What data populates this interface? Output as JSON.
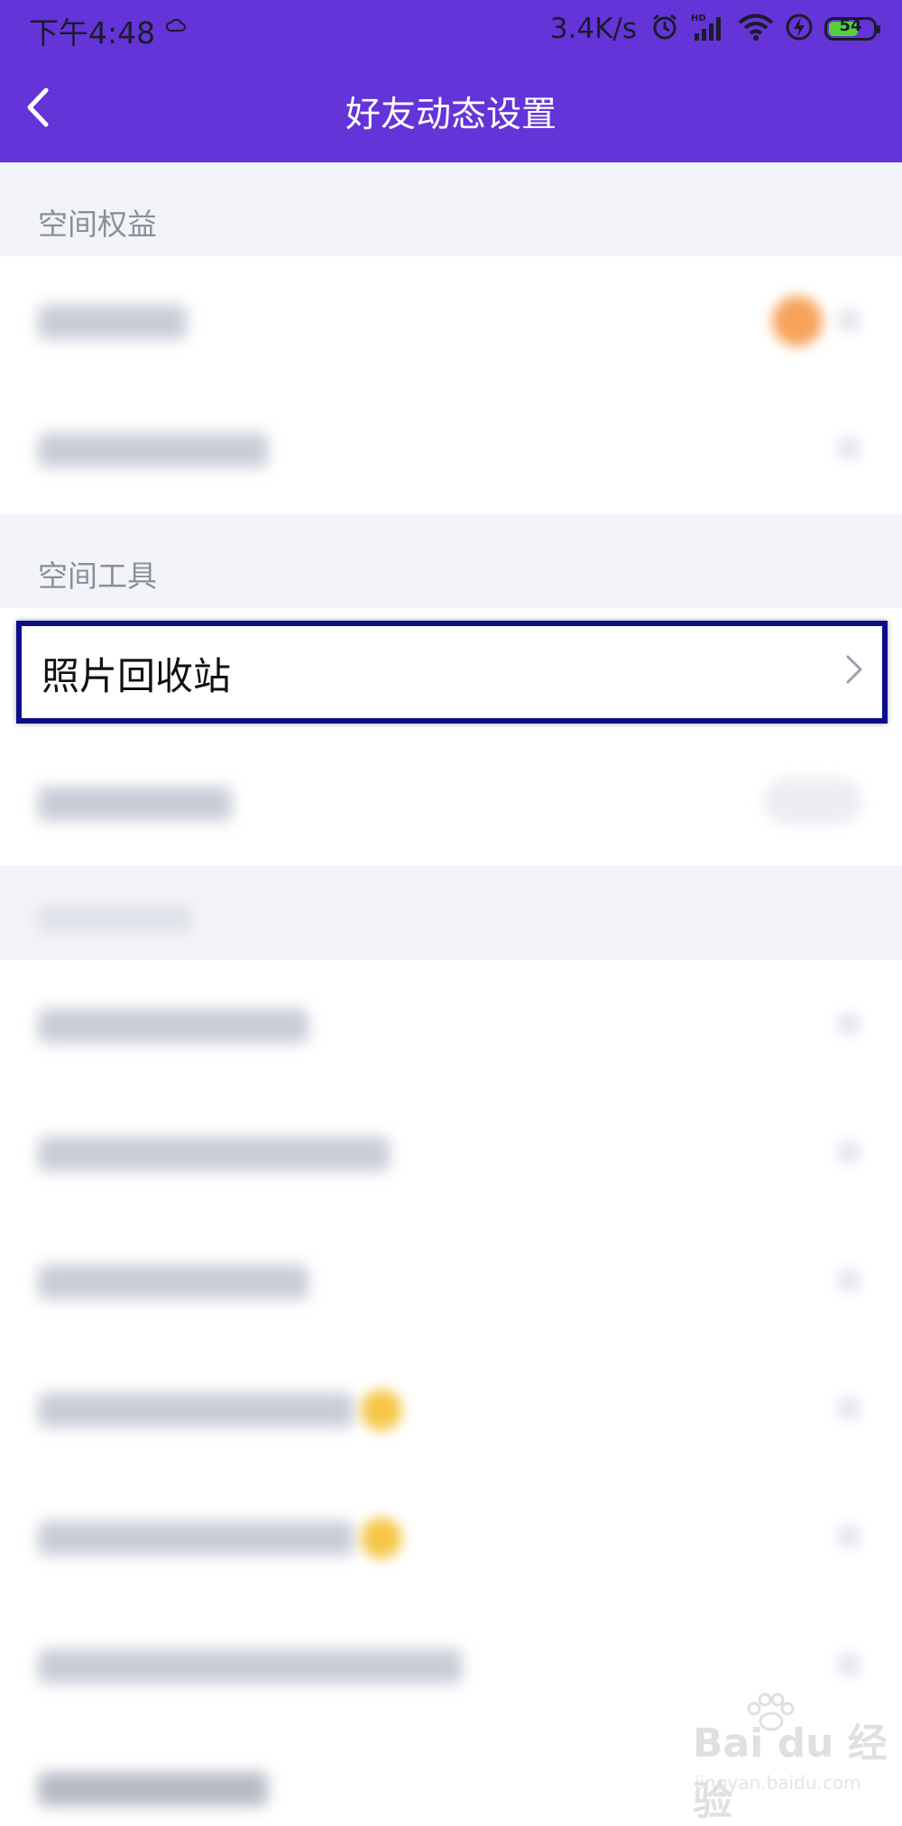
{
  "status_bar": {
    "time": "下午4:48",
    "net_speed": "3.4K/s",
    "battery_level": "54",
    "icons": [
      "cloud-icon",
      "alarm-icon",
      "signal-hd-icon",
      "wifi-icon",
      "charging-icon",
      "battery-icon"
    ]
  },
  "nav": {
    "title": "好友动态设置",
    "back_icon": "back-arrow-icon"
  },
  "sections": [
    {
      "title": "空间权益"
    },
    {
      "title": "空间工具"
    }
  ],
  "tools": {
    "photo_recycle_bin_label": "照片回收站",
    "chevron_icon": "chevron-right-icon"
  },
  "watermark": {
    "brand": "Bai du 经验",
    "url": "jingyan.baidu.com"
  },
  "colors": {
    "header_bg": "#6434d8",
    "section_bg": "#f3f4f8",
    "highlight_border": "#0d0d88",
    "badge_orange": "#f7a35c",
    "badge_yellow": "#f5c74a"
  }
}
